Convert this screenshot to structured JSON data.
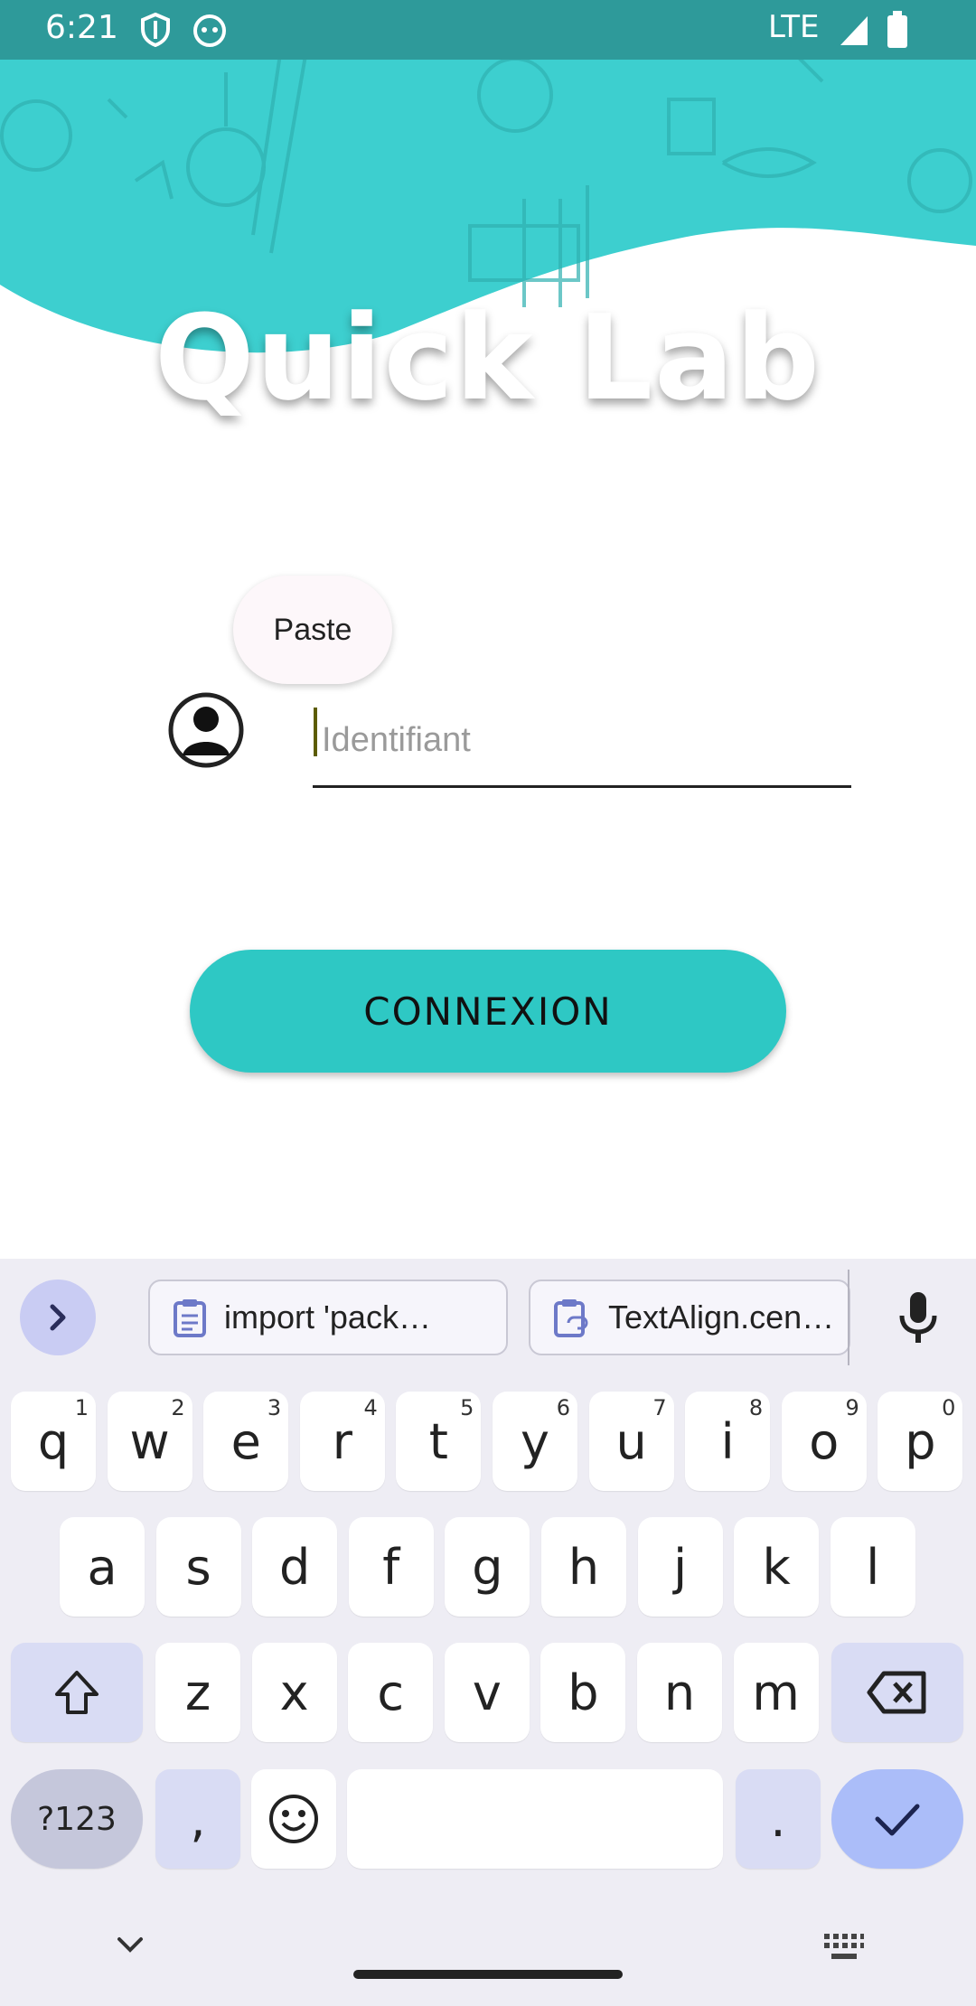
{
  "status_bar": {
    "time": "6:21",
    "network": "LTE"
  },
  "app": {
    "title": "Quick Lab"
  },
  "paste_popup": {
    "label": "Paste"
  },
  "login": {
    "identifier_placeholder": "Identifiant",
    "connect_label": "CONNEXION"
  },
  "colors": {
    "accent": "#2ec8c4",
    "header_bg": "#3dcfcf",
    "status_bar": "#2e9a9a",
    "keyboard_bg": "#eeedf4",
    "modifier_key": "#d9dcf4"
  },
  "keyboard": {
    "clipboard_chips": [
      "import 'pack…",
      "TextAlign.cen…"
    ],
    "row1": [
      {
        "k": "q",
        "n": "1"
      },
      {
        "k": "w",
        "n": "2"
      },
      {
        "k": "e",
        "n": "3"
      },
      {
        "k": "r",
        "n": "4"
      },
      {
        "k": "t",
        "n": "5"
      },
      {
        "k": "y",
        "n": "6"
      },
      {
        "k": "u",
        "n": "7"
      },
      {
        "k": "i",
        "n": "8"
      },
      {
        "k": "o",
        "n": "9"
      },
      {
        "k": "p",
        "n": "0"
      }
    ],
    "row2": [
      "a",
      "s",
      "d",
      "f",
      "g",
      "h",
      "j",
      "k",
      "l"
    ],
    "row3": [
      "z",
      "x",
      "c",
      "v",
      "b",
      "n",
      "m"
    ],
    "symbols_label": "?123",
    "comma": ",",
    "period": ".",
    "icons": {
      "expand": "chevron-right-icon",
      "mic": "microphone-icon",
      "shift": "shift-icon",
      "backspace": "backspace-icon",
      "emoji": "emoji-icon",
      "enter": "check-icon",
      "hide": "chevron-down-icon",
      "switch": "keyboard-icon"
    }
  }
}
